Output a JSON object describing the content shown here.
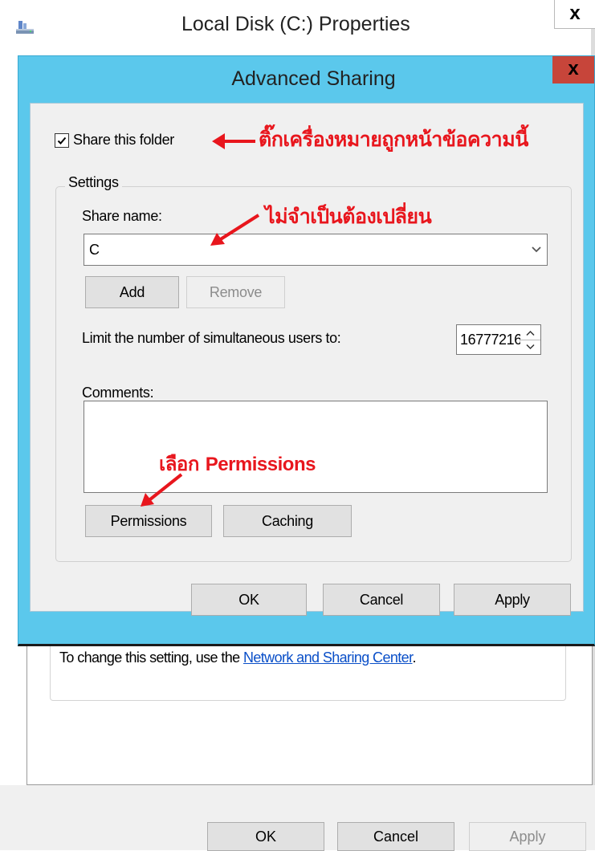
{
  "background_window": {
    "title": "Local Disk (C:) Properties",
    "close_glyph": "x",
    "info_prefix": "To change this setting, use the ",
    "info_link": "Network and Sharing Center",
    "info_suffix": ".",
    "ok_label": "OK",
    "cancel_label": "Cancel",
    "apply_label": "Apply"
  },
  "dialog": {
    "title": "Advanced Sharing",
    "close_glyph": "x",
    "share_checkbox_label": "Share this folder",
    "share_checked": true,
    "settings_legend": "Settings",
    "share_name_label": "Share name:",
    "share_name_value": "C",
    "add_label": "Add",
    "remove_label": "Remove",
    "limit_label": "Limit the number of simultaneous users to:",
    "limit_value": "16777216",
    "comments_label": "Comments:",
    "comments_value": "",
    "permissions_label": "Permissions",
    "caching_label": "Caching",
    "ok_label": "OK",
    "cancel_label": "Cancel",
    "apply_label": "Apply"
  },
  "annotations": {
    "share_note": "ติ๊กเครื่องหมายถูกหน้าข้อความนี้",
    "name_note": "ไม่จำเป็นต้องเปลี่ยน",
    "perm_note_prefix": "เลือก ",
    "perm_note_bold": "Permissions",
    "color": "#e8161d"
  },
  "icons": {
    "app": "network-drive-icon",
    "close": "close-icon",
    "check": "checkmark-icon",
    "dropdown": "chevron-down-icon",
    "spin_up": "spin-up-icon",
    "spin_down": "spin-down-icon",
    "arrow": "red-arrow-icon"
  },
  "colors": {
    "dialog_frame": "#5bc8ec",
    "close_button": "#c7453a",
    "dialog_body": "#f0f0f0",
    "link": "#0a4fc8"
  }
}
